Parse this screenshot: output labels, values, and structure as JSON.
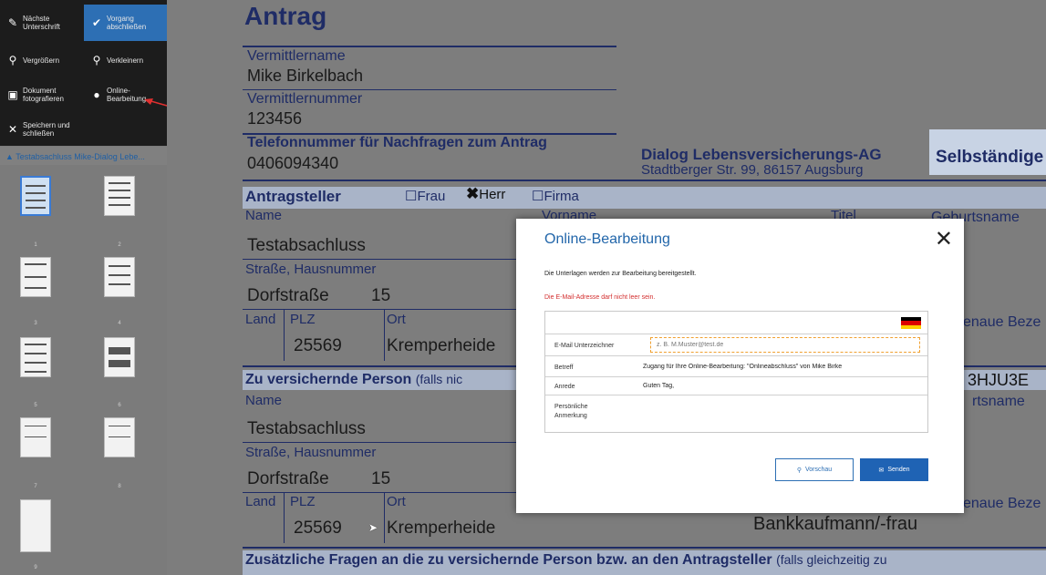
{
  "toolbar": {
    "next_signature": "Nächste Unterschrift",
    "finish_process": "Vorgang abschließen",
    "zoom_in": "Vergrößern",
    "zoom_out": "Verkleinern",
    "photo_document": "Dokument fotografieren",
    "online_editing": "Online-Bearbeitung",
    "save_close": "Speichern und schließen"
  },
  "tree": {
    "label": "Testabsachluss Mike-Dialog Lebe..."
  },
  "thumbnails": [
    "1",
    "2",
    "3",
    "4",
    "5",
    "6",
    "7",
    "8",
    "9"
  ],
  "document": {
    "title": "Antrag",
    "broker_name_label": "Vermittlername",
    "broker_name": "Mike Birkelbach",
    "broker_number_label": "Vermittlernummer",
    "broker_number": "123456",
    "phone_label": "Telefonnummer für Nachfragen zum Antrag",
    "phone": "0406094340",
    "company": "Dialog Lebensversicherungs-AG",
    "address": "Stadtberger Str. 99, 86157 Augsburg",
    "selbst": "Selbständige",
    "applicant": "Antragsteller",
    "opt_frau": "Frau",
    "opt_herr": "Herr",
    "opt_firma": "Firma",
    "name_label": "Name",
    "vorname_label": "Vorname",
    "titel_label": "Titel",
    "geburtsname_label": "Geburtsname",
    "name_value": "Testabsachluss",
    "street_label": "Straße, Hausnummer",
    "street": "Dorfstraße",
    "house_no": "15",
    "land_label": "Land",
    "plz_label": "PLZ",
    "ort_label": "Ort",
    "plz": "25569",
    "ort": "Kremperheide",
    "genaue": "enaue Beze",
    "insured": "Zu versichernde Person",
    "insured_suffix": "(falls nic",
    "code": "3HJU3E",
    "rtsname": "rtsname",
    "name_value2": "Testabsachluss",
    "street2": "Dorfstraße",
    "house_no2": "15",
    "plz2": "25569",
    "ort2": "Kremperheide",
    "occupation": "Bankkaufmann/-frau",
    "genaue2": "enaue Beze",
    "extra_questions": "Zusätzliche Fragen an die zu versichernde Person bzw. an den Antragsteller",
    "extra_suffix": "(falls gleichzeitig zu"
  },
  "dialog": {
    "title": "Online-Bearbeitung",
    "info": "Die Unterlagen werden zur Bearbeitung bereitgestellt.",
    "error": "Die E-Mail-Adresse darf nicht leer sein.",
    "email_label": "E-Mail Unterzeichner",
    "email_placeholder": "z. B. M.Muster@test.de",
    "subject_label": "Betreff",
    "subject_value": "Zugang für Ihre Online-Bearbeitung: \"Onlineabschluss\" von Mike Birke",
    "salutation_label": "Anrede",
    "salutation_value": "Guten Tag,",
    "note_label": "Persönliche Anmerkung",
    "preview_button": "Vorschau",
    "send_button": "Senden"
  }
}
